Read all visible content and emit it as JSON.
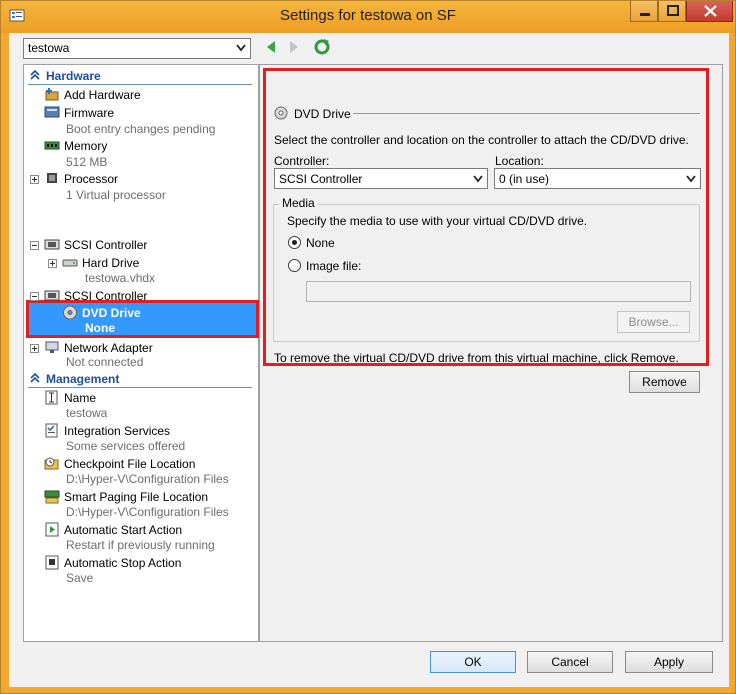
{
  "window": {
    "title": "Settings for testowa on SF",
    "icon": "settings-icon"
  },
  "vm_selector": {
    "value": "testowa"
  },
  "tree": {
    "hardware_header": "Hardware",
    "management_header": "Management",
    "hardware_items": [
      {
        "label": "Add Hardware",
        "icon": "add-hardware-icon"
      },
      {
        "label": "Firmware",
        "sub": "Boot entry changes pending",
        "icon": "firmware-icon"
      },
      {
        "label": "Memory",
        "sub": "512 MB",
        "icon": "memory-icon"
      },
      {
        "label": "Processor",
        "sub": "1 Virtual processor",
        "icon": "processor-icon"
      },
      {
        "label": "SCSI Controller",
        "icon": "scsi-controller-icon"
      },
      {
        "label": "Hard Drive",
        "sub": "testowa.vhdx",
        "icon": "hard-drive-icon"
      },
      {
        "label": "SCSI Controller",
        "icon": "scsi-controller-icon"
      },
      {
        "label": "DVD Drive",
        "sub": "None",
        "icon": "dvd-drive-icon",
        "selected": true
      },
      {
        "label": "Network Adapter",
        "sub": "Not connected",
        "icon": "network-adapter-icon"
      }
    ],
    "management_items": [
      {
        "label": "Name",
        "sub": "testowa",
        "icon": "name-icon"
      },
      {
        "label": "Integration Services",
        "sub": "Some services offered",
        "icon": "integration-services-icon"
      },
      {
        "label": "Checkpoint File Location",
        "sub": "D:\\Hyper-V\\Configuration Files",
        "icon": "checkpoint-icon"
      },
      {
        "label": "Smart Paging File Location",
        "sub": "D:\\Hyper-V\\Configuration Files",
        "icon": "smart-paging-icon"
      },
      {
        "label": "Automatic Start Action",
        "sub": "Restart if previously running",
        "icon": "start-action-icon"
      },
      {
        "label": "Automatic Stop Action",
        "sub": "Save",
        "icon": "stop-action-icon"
      }
    ]
  },
  "dvd_panel": {
    "title": "DVD Drive",
    "description": "Select the controller and location on the controller to attach the CD/DVD drive.",
    "controller_label": "Controller:",
    "controller_value": "SCSI Controller",
    "location_label": "Location:",
    "location_value": "0 (in use)",
    "media_title": "Media",
    "media_description": "Specify the media to use with your virtual CD/DVD drive.",
    "option_none": "None",
    "option_image": "Image file:",
    "image_path": "",
    "browse_label": "Browse...",
    "remove_note": "To remove the virtual CD/DVD drive from this virtual machine, click Remove.",
    "remove_label": "Remove"
  },
  "footer": {
    "ok_label": "OK",
    "cancel_label": "Cancel",
    "apply_label": "Apply"
  },
  "colors": {
    "window_frame": "#f0a830",
    "selection": "#3399ff",
    "highlight_outline": "#e02020",
    "section_header": "#1f4e9c"
  }
}
